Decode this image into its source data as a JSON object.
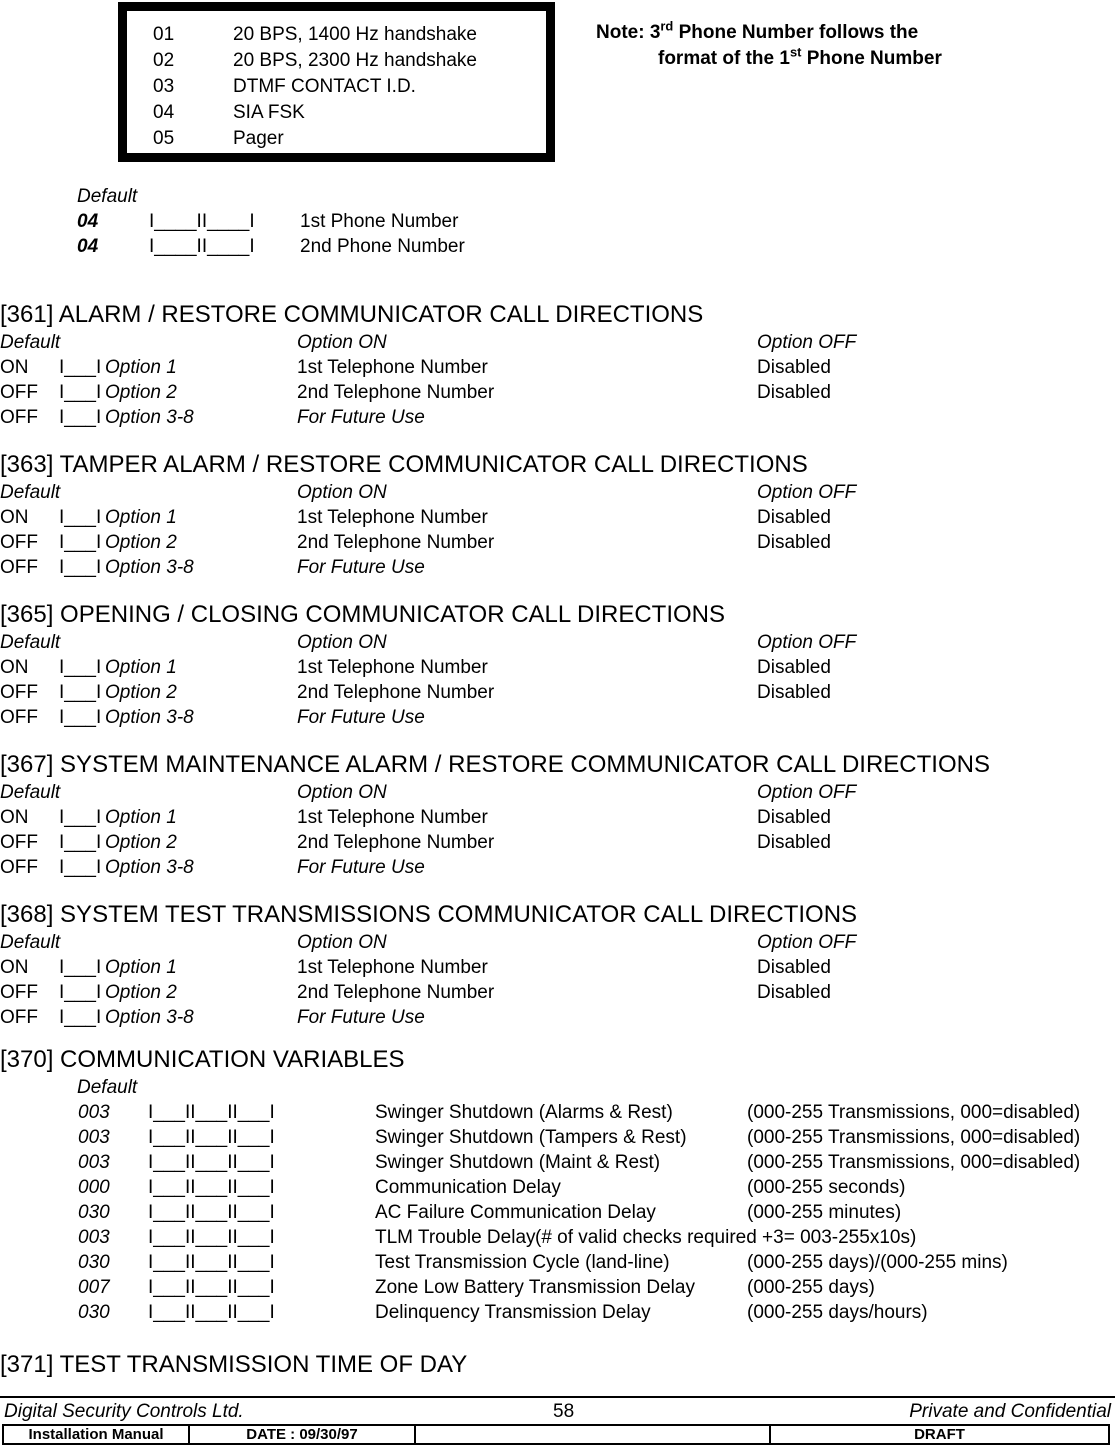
{
  "code_box": {
    "rows": [
      {
        "code": "01",
        "label": "20 BPS, 1400 Hz handshake"
      },
      {
        "code": "02",
        "label": "20 BPS, 2300 Hz handshake"
      },
      {
        "code": "03",
        "label": "DTMF CONTACT I.D."
      },
      {
        "code": "04",
        "label": "SIA FSK"
      },
      {
        "code": "05",
        "label": "Pager"
      }
    ]
  },
  "note": {
    "line1_pre": "Note: 3",
    "line1_sup": "rd",
    "line1_post": " Phone Number follows the",
    "line2_pre": "format of the 1",
    "line2_sup": "st",
    "line2_post": " Phone Number"
  },
  "phone_block": {
    "default_label": "Default",
    "rows": [
      {
        "default": "04",
        "blank": "I____II____I",
        "label": "1st Phone Number"
      },
      {
        "default": "04",
        "blank": "I____II____I",
        "label": "2nd Phone Number"
      }
    ]
  },
  "option_sections": [
    {
      "title": "[361] ALARM / RESTORE COMMUNICATOR CALL DIRECTIONS",
      "header": {
        "default": "Default",
        "on": "Option ON",
        "off": "Option OFF"
      },
      "rows": [
        {
          "default": "ON",
          "blank": "I___I",
          "name": "Option 1",
          "on": "1st Telephone Number",
          "on_italic": false,
          "off": "Disabled"
        },
        {
          "default": "OFF",
          "blank": "I___I",
          "name": "Option 2",
          "on": "2nd Telephone Number",
          "on_italic": false,
          "off": "Disabled"
        },
        {
          "default": "OFF",
          "blank": "I___I",
          "name": "Option 3-8",
          "on": "For Future Use",
          "on_italic": true,
          "off": ""
        }
      ]
    },
    {
      "title": "[363] TAMPER ALARM / RESTORE COMMUNICATOR CALL DIRECTIONS",
      "header": {
        "default": "Default",
        "on": "Option ON",
        "off": "Option OFF"
      },
      "rows": [
        {
          "default": "ON",
          "blank": "I___I",
          "name": "Option 1",
          "on": "1st Telephone Number",
          "on_italic": false,
          "off": "Disabled"
        },
        {
          "default": "OFF",
          "blank": "I___I",
          "name": "Option 2",
          "on": "2nd Telephone Number",
          "on_italic": false,
          "off": "Disabled"
        },
        {
          "default": "OFF",
          "blank": "I___I",
          "name": "Option 3-8",
          "on": "For Future Use",
          "on_italic": true,
          "off": ""
        }
      ]
    },
    {
      "title": "[365] OPENING / CLOSING COMMUNICATOR CALL DIRECTIONS",
      "header": {
        "default": "Default",
        "on": "Option ON",
        "off": "Option OFF"
      },
      "rows": [
        {
          "default": "ON",
          "blank": "I___I",
          "name": "Option 1",
          "on": "1st Telephone Number",
          "on_italic": false,
          "off": "Disabled"
        },
        {
          "default": "OFF",
          "blank": "I___I",
          "name": "Option 2",
          "on": "2nd Telephone Number",
          "on_italic": false,
          "off": "Disabled"
        },
        {
          "default": "OFF",
          "blank": "I___I",
          "name": "Option 3-8",
          "on": "For Future Use",
          "on_italic": true,
          "off": ""
        }
      ]
    },
    {
      "title": "[367] SYSTEM MAINTENANCE ALARM / RESTORE COMMUNICATOR CALL DIRECTIONS",
      "header": {
        "default": "Default",
        "on": "Option ON",
        "off": "Option OFF"
      },
      "rows": [
        {
          "default": "ON",
          "blank": "I___I",
          "name": "Option 1",
          "on": "1st Telephone Number",
          "on_italic": false,
          "off": "Disabled"
        },
        {
          "default": "OFF",
          "blank": "I___I",
          "name": "Option 2",
          "on": "2nd Telephone Number",
          "on_italic": false,
          "off": "Disabled"
        },
        {
          "default": "OFF",
          "blank": "I___I",
          "name": "Option 3-8",
          "on": "For Future Use",
          "on_italic": true,
          "off": ""
        }
      ]
    },
    {
      "title": "[368] SYSTEM TEST TRANSMISSIONS COMMUNICATOR CALL DIRECTIONS",
      "header": {
        "default": "Default",
        "on": "Option ON",
        "off": "Option OFF"
      },
      "rows": [
        {
          "default": "ON",
          "blank": "I___I",
          "name": "Option 1",
          "on": "1st Telephone Number",
          "on_italic": false,
          "off": "Disabled"
        },
        {
          "default": "OFF",
          "blank": "I___I",
          "name": "Option 2",
          "on": "2nd Telephone Number",
          "on_italic": false,
          "off": "Disabled"
        },
        {
          "default": "OFF",
          "blank": "I___I",
          "name": "Option 3-8",
          "on": "For Future Use",
          "on_italic": true,
          "off": ""
        }
      ]
    }
  ],
  "comm_vars": {
    "title": "[370] COMMUNICATION VARIABLES",
    "default_label": "Default",
    "rows": [
      {
        "default": "003",
        "blank": "I___II___II___I",
        "desc": "Swinger Shutdown (Alarms & Rest)",
        "range": "(000-255 Transmissions, 000=disabled)",
        "range_early": false
      },
      {
        "default": "003",
        "blank": "I___II___II___I",
        "desc": "Swinger Shutdown (Tampers & Rest)",
        "range": "(000-255 Transmissions, 000=disabled)",
        "range_early": false
      },
      {
        "default": "003",
        "blank": "I___II___II___I",
        "desc": "Swinger Shutdown (Maint & Rest)",
        "range": "(000-255 Transmissions, 000=disabled)",
        "range_early": false
      },
      {
        "default": "000",
        "blank": "I___II___II___I",
        "desc": "Communication Delay",
        "range": "(000-255 seconds)",
        "range_early": false
      },
      {
        "default": "030",
        "blank": "I___II___II___I",
        "desc": "AC Failure Communication Delay",
        "range": "(000-255 minutes)",
        "range_early": false
      },
      {
        "default": "003",
        "blank": "I___II___II___I",
        "desc": "TLM Trouble Delay",
        "range": "(# of valid checks required +3= 003-255x10s)",
        "range_early": true
      },
      {
        "default": "030",
        "blank": "I___II___II___I",
        "desc": "Test Transmission Cycle (land-line)",
        "range": "(000-255 days)/(000-255 mins)",
        "range_early": false
      },
      {
        "default": "007",
        "blank": "I___II___II___I",
        "desc": "Zone Low Battery Transmission Delay",
        "range": "(000-255 days)",
        "range_early": false
      },
      {
        "default": "030",
        "blank": "I___II___II___I",
        "desc": "Delinquency Transmission Delay",
        "range": "(000-255 days/hours)",
        "range_early": false
      }
    ]
  },
  "test_transmission": {
    "title": "[371] TEST TRANSMISSION TIME OF DAY"
  },
  "footer": {
    "company": "Digital Security Controls Ltd.",
    "page_number": "58",
    "confidentiality": "Private and Confidential",
    "cells": [
      "Installation Manual",
      "DATE :  09/30/97",
      "",
      "DRAFT"
    ]
  }
}
